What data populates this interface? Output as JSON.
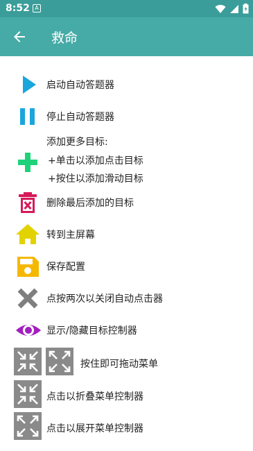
{
  "status": {
    "time": "8:52",
    "notif_letter": "A"
  },
  "appbar": {
    "title": "救命"
  },
  "items": {
    "start": "启动自动答题器",
    "stop": "停止自动答题器",
    "add_header": "添加更多目标:",
    "add_click": "+单击以添加点击目标",
    "add_swipe": "+按住以添加滑动目标",
    "delete_last": "删除最后添加的目标",
    "home": "转到主屏幕",
    "save": "保存配置",
    "close": "点按两次以关闭自动点击器",
    "toggle_targets": "显示/隐藏目标控制器",
    "drag_menu": "按住即可拖动菜单",
    "collapse": "点击以折叠菜单控制器",
    "expand": "点击以展开菜单控制器"
  },
  "colors": {
    "statusbar": "#3a9d9a",
    "appbar": "#46aaa6",
    "play": "#1aa6dc",
    "pause": "#1aa6dc",
    "add": "#1fd27a",
    "delete": "#d6195a",
    "home": "#e2d200",
    "save": "#f5b800",
    "close": "#7f7f7f",
    "eye": "#a21fbe",
    "frame": "#8a8a8a"
  }
}
